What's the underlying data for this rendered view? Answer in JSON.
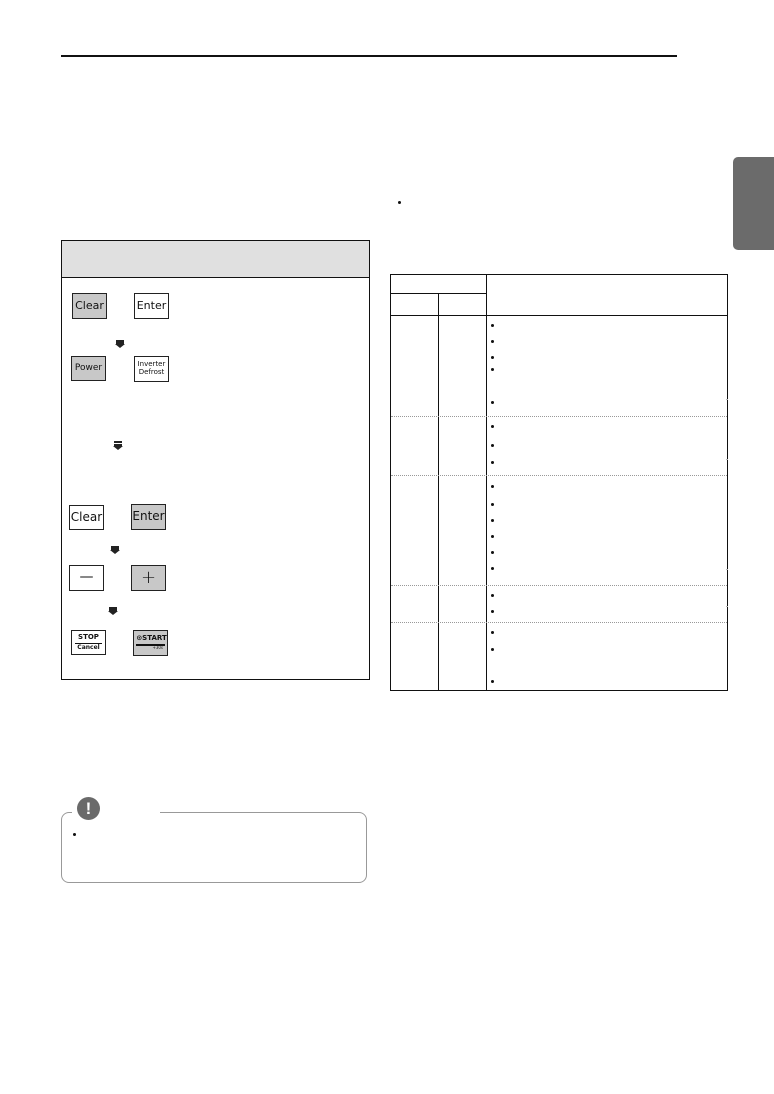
{
  "page": {
    "side_tab": {
      "color": "#6b6b6b"
    },
    "intro_bullet": {
      "text": ""
    }
  },
  "procedure_box": {
    "header_text": "",
    "steps": [
      {
        "keys": [
          {
            "label": "Clear",
            "highlighted": true
          },
          {
            "label": "Enter",
            "highlighted": false
          }
        ],
        "arrow_after": "single"
      },
      {
        "keys": [
          {
            "label": "Power",
            "highlighted": true
          },
          {
            "label": "Inverter Defrost",
            "highlighted": false
          }
        ],
        "arrow_after": "double"
      },
      {
        "keys": [
          {
            "label": "Clear",
            "highlighted": false
          },
          {
            "label": "Enter",
            "highlighted": true
          }
        ],
        "arrow_after": "single"
      },
      {
        "keys": [
          {
            "label": "—",
            "highlighted": false
          },
          {
            "label": "+",
            "highlighted": true
          }
        ],
        "arrow_after": "single"
      },
      {
        "keys": [
          {
            "label_top": "STOP",
            "label_bottom": "Cancel",
            "highlighted": false
          },
          {
            "label_top": "⊙START",
            "label_bottom": "+30s",
            "highlighted": true
          }
        ],
        "arrow_after": null
      }
    ],
    "key_labels": {
      "clear": "Clear",
      "enter": "Enter",
      "power": "Power",
      "inverter_line1": "Inverter",
      "inverter_line2": "Defrost",
      "minus": "—",
      "plus": "+",
      "stop": "STOP",
      "cancel": "Cancel",
      "start": "⊙START",
      "plus30": "+30s"
    }
  },
  "note": {
    "icon": "exclamation-icon",
    "icon_glyph": "!",
    "bullets": [
      ""
    ]
  },
  "table": {
    "header": {
      "group": "",
      "col1": "",
      "col2": "",
      "description": ""
    },
    "rows": [
      {
        "col1": "",
        "col2": "",
        "bullets": [
          "",
          "",
          "",
          "",
          ""
        ]
      },
      {
        "col1": "",
        "col2": "",
        "bullets": [
          "",
          "",
          ""
        ]
      },
      {
        "col1": "",
        "col2": "",
        "bullets": [
          "",
          "",
          "",
          "",
          "",
          ""
        ]
      },
      {
        "col1": "",
        "col2": "",
        "bullets": [
          "",
          ""
        ]
      },
      {
        "col1": "",
        "col2": "",
        "bullets": [
          "",
          "",
          ""
        ]
      }
    ]
  }
}
